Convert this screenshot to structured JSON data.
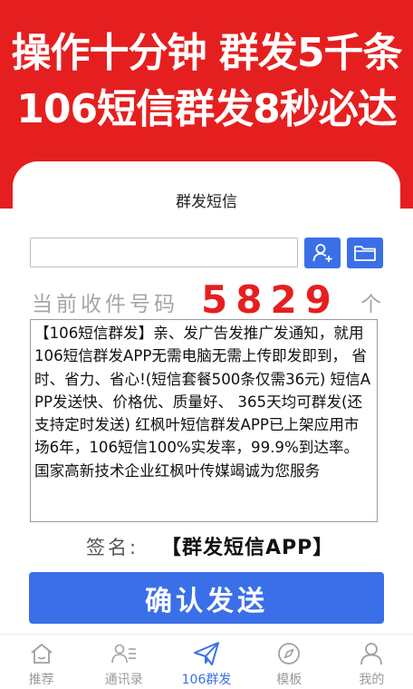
{
  "banner": {
    "line1": "操作十分钟 群发5千条",
    "line2": "106短信群发8秒必达"
  },
  "app": {
    "title": "群发短信"
  },
  "recipient": {
    "placeholder": "",
    "value": ""
  },
  "count": {
    "label": "当前收件号码",
    "value": "5829",
    "unit": "个"
  },
  "message": {
    "text": "【106短信群发】亲、发广告发推广发通知，就用106短信群发APP无需电脑无需上传即发即到， 省时、省力、省心!(短信套餐500条仅需36元) 短信APP发送快、价格优、质量好、 365天均可群发(还支持定时发送) 红枫叶短信群发APP已上架应用市场6年，106短信100%实发率，99.9%到达率。国家高新技术企业红枫叶传媒竭诚为您服务"
  },
  "signature": {
    "label": "签名:",
    "value": "【群发短信APP】"
  },
  "confirm": {
    "label": "确认发送"
  },
  "colors": {
    "brand_red": "#e51f1f",
    "accent_blue": "#3a6fe8"
  },
  "tabs": [
    {
      "label": "推荐",
      "icon": "home-icon",
      "active": false
    },
    {
      "label": "通讯录",
      "icon": "contacts-icon",
      "active": false
    },
    {
      "label": "106群发",
      "icon": "send-icon",
      "active": true
    },
    {
      "label": "模板",
      "icon": "compass-icon",
      "active": false
    },
    {
      "label": "我的",
      "icon": "profile-icon",
      "active": false
    }
  ]
}
